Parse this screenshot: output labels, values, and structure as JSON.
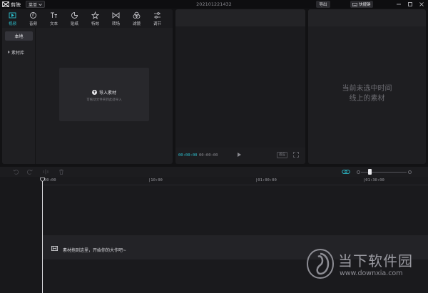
{
  "app": {
    "name": "剪映",
    "menu_label": "菜单",
    "project_title": "20210122143​2"
  },
  "titlebar": {
    "export_label": "导出",
    "shortcut_label": "快捷键"
  },
  "media": {
    "tabs": [
      {
        "label": "视频",
        "icon": "video-icon",
        "active": true
      },
      {
        "label": "音频",
        "icon": "audio-icon",
        "active": false
      },
      {
        "label": "文本",
        "icon": "text-icon",
        "active": false
      },
      {
        "label": "贴纸",
        "icon": "sticker-icon",
        "active": false
      },
      {
        "label": "特效",
        "icon": "effects-icon",
        "active": false
      },
      {
        "label": "转场",
        "icon": "transition-icon",
        "active": false
      },
      {
        "label": "滤镜",
        "icon": "filter-icon",
        "active": false
      },
      {
        "label": "调节",
        "icon": "adjust-icon",
        "active": false
      }
    ],
    "sidebar": {
      "local": "本地",
      "library": "素材库"
    },
    "import": {
      "label": "导入素材",
      "hint": "可拖动文件夹到此处导入"
    }
  },
  "player": {
    "current_time": "00:00:00",
    "total_time": "00:00:00",
    "ratio_label": "适应"
  },
  "properties": {
    "empty_text": "当前未选中时间\n线上的素材"
  },
  "timeline": {
    "ruler": [
      "00:00",
      "|10:00",
      "|01:00:00",
      "|01:30:00"
    ],
    "track_hint": "素材拖到这里，开始你的大作吧~"
  },
  "watermark": {
    "cn": "当下软件园",
    "url": "www.downxia.com"
  },
  "colors": {
    "accent": "#2cc0cf",
    "background": "#121214",
    "panel": "#1e1e21"
  }
}
